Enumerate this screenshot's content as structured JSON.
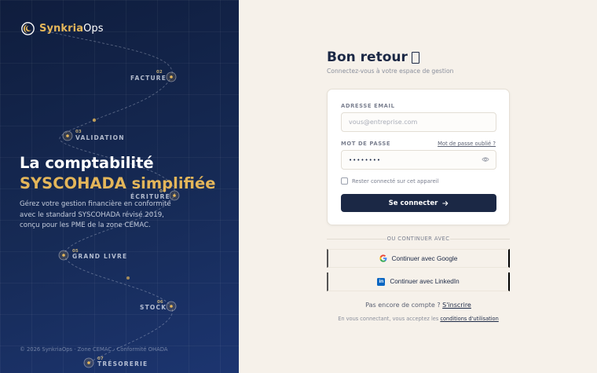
{
  "brand": {
    "name_primary": "Synkria",
    "name_secondary": "Ops"
  },
  "colors": {
    "navy": "#1b2845",
    "gold": "#e4b65a",
    "cream": "#f6f1ea",
    "linkedin": "#0a66c2"
  },
  "journey": [
    {
      "num": "02",
      "label": "FACTURE"
    },
    {
      "num": "03",
      "label": "VALIDATION"
    },
    {
      "num": "04",
      "label": "ÉCRITURE"
    },
    {
      "num": "05",
      "label": "GRAND LIVRE"
    },
    {
      "num": "06",
      "label": "STOCK"
    },
    {
      "num": "07",
      "label": "TRÉSORERIE"
    }
  ],
  "hero": {
    "title_line1": "La comptabilité",
    "title_line2": "SYSCOHADA simplifiée",
    "description": "Gérez votre gestion financière en conformité avec le standard SYSCOHADA révisé 2019, conçu pour les PME de la zone CEMAC."
  },
  "left_footer": "© 2026 SynkriaOps · Zone CEMAC · Conformité OHADA",
  "login": {
    "title": "Bon retour",
    "title_icon": "waving-hand-icon",
    "subtitle": "Connectez-vous à votre espace de gestion",
    "email_label": "ADRESSE EMAIL",
    "email_placeholder": "vous@entreprise.com",
    "password_label": "MOT DE PASSE",
    "password_value": "••••••••",
    "forgot_label": "Mot de passe oublié ?",
    "remember_label": "Rester connecté sur cet appareil",
    "submit_label": "Se connecter",
    "divider_label": "OU CONTINUER AVEC",
    "google_label": "Continuer avec Google",
    "linkedin_label": "Continuer avec LinkedIn",
    "linkedin_glyph": "in",
    "signup_prompt": "Pas encore de compte ?",
    "signup_link": "S'inscrire",
    "terms_prefix": "En vous connectant, vous acceptez les",
    "terms_link": "conditions d'utilisation"
  }
}
